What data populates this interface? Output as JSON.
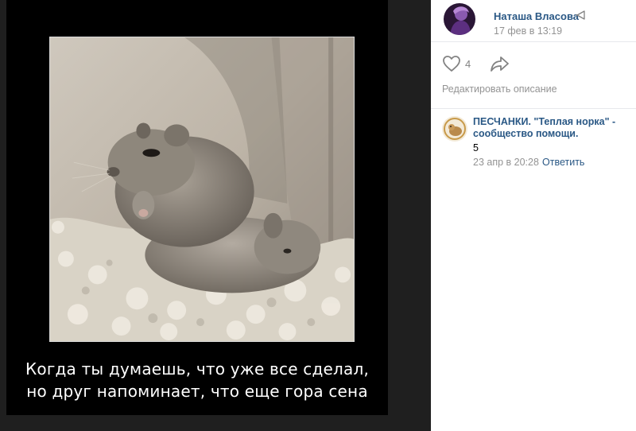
{
  "photo": {
    "caption_line1": "Когда ты думаешь, что уже все сделал,",
    "caption_line2": "но друг напоминает, что еще гора сена"
  },
  "post": {
    "author_name": "Наташа Власова",
    "date": "17 фев в 13:19",
    "likes": "4",
    "edit_description_label": "Редактировать описание"
  },
  "comments": [
    {
      "author": "ПЕСЧАНКИ. \"Теплая норка\" - сообщество помощи.",
      "text": "5",
      "date": "23 апр в 20:28",
      "reply_label": "Ответить"
    }
  ],
  "icons": {
    "like": "heart-icon",
    "share": "share-arrow-icon",
    "author_badge": "broadcast-icon"
  },
  "colors": {
    "link": "#2a5885",
    "muted": "#939393",
    "viewer_bg": "#1f1f1f"
  }
}
